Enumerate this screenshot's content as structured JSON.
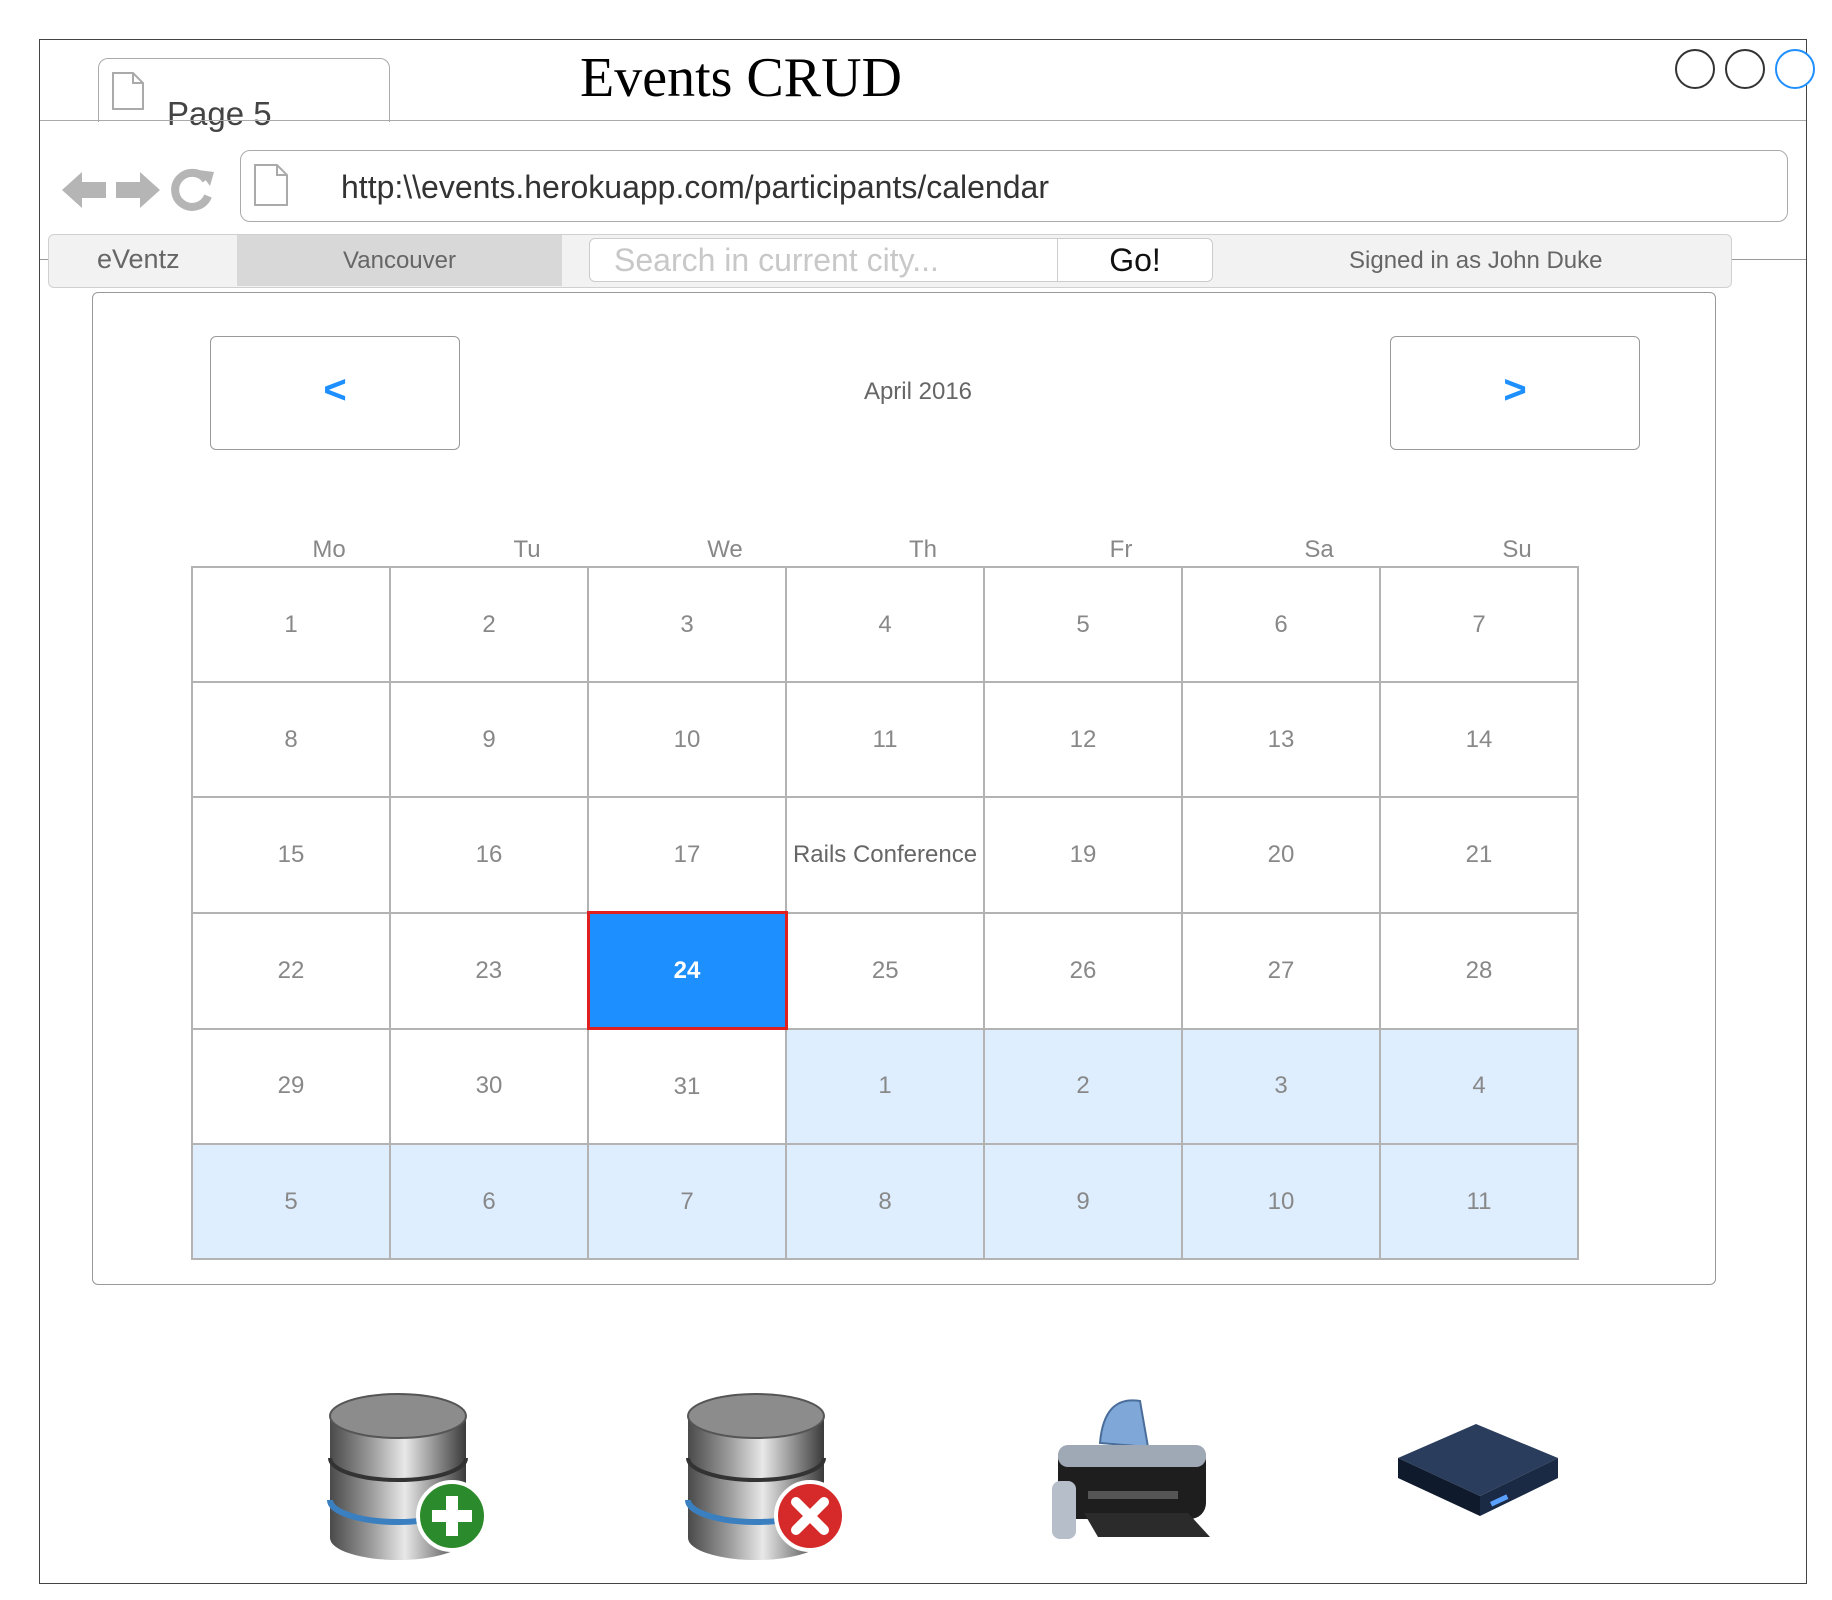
{
  "browser": {
    "title": "Events CRUD",
    "tab_label": "Page 5",
    "url": "http:\\\\events.herokuapp.com/participants/calendar"
  },
  "nav": {
    "brand": "eVentz",
    "city": "Vancouver",
    "search_placeholder": "Search in current city...",
    "go_label": "Go!",
    "signed_in": "Signed in as John Duke"
  },
  "calendar": {
    "prev_label": "<",
    "next_label": ">",
    "month_label": "April 2016",
    "weekdays": [
      "Mo",
      "Tu",
      "We",
      "Th",
      "Fr",
      "Sa",
      "Su"
    ],
    "weeks": [
      [
        "1",
        "2",
        "3",
        "4",
        "5",
        "6",
        "7"
      ],
      [
        "8",
        "9",
        "10",
        "11",
        "12",
        "13",
        "14"
      ],
      [
        "15",
        "16",
        "17",
        "Rails Conference",
        "19",
        "20",
        "21"
      ],
      [
        "22",
        "23",
        "24",
        "25",
        "26",
        "27",
        "28"
      ],
      [
        "29",
        "30",
        "31",
        "1",
        "2",
        "3",
        "4"
      ],
      [
        "5",
        "6",
        "7",
        "8",
        "9",
        "10",
        "11"
      ]
    ],
    "selected_day": "24",
    "colors": {
      "accent": "#1e8fff",
      "selected_border": "#e02020",
      "other_month_bg": "#deeeff"
    }
  },
  "toolbar": {
    "icons": [
      "database-add-icon",
      "database-delete-icon",
      "printer-icon",
      "hard-drive-icon"
    ]
  }
}
